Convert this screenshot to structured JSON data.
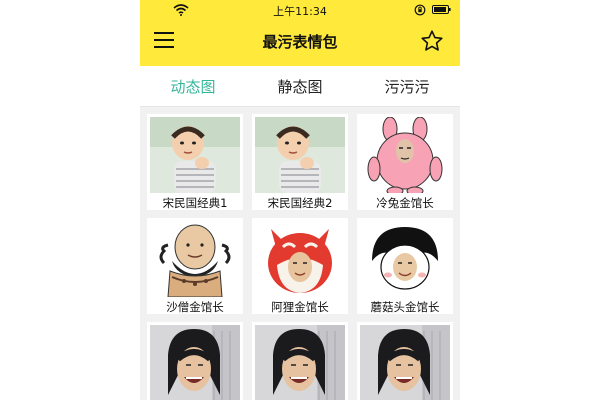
{
  "status_bar": {
    "time": "上午11:34"
  },
  "header": {
    "title": "最污表情包",
    "menu_icon": "menu-icon",
    "star_icon": "star-icon"
  },
  "tabs": [
    {
      "label": "动态图",
      "active": true
    },
    {
      "label": "静态图",
      "active": false
    },
    {
      "label": "污污污",
      "active": false
    }
  ],
  "accent_color": "#35b69a",
  "header_color": "#ffe93b",
  "stickers": [
    {
      "caption": "宋民国经典1",
      "image": "boy-photo"
    },
    {
      "caption": "宋民国经典2",
      "image": "boy-photo"
    },
    {
      "caption": "冷兔金馆长",
      "image": "pink-rabbit"
    },
    {
      "caption": "沙僧金馆长",
      "image": "bald-monk"
    },
    {
      "caption": "阿狸金馆长",
      "image": "red-fox"
    },
    {
      "caption": "蘑菇头金馆长",
      "image": "mushroom-head"
    },
    {
      "caption": "",
      "image": "laughing-man"
    },
    {
      "caption": "",
      "image": "laughing-man"
    },
    {
      "caption": "",
      "image": "laughing-man"
    }
  ]
}
